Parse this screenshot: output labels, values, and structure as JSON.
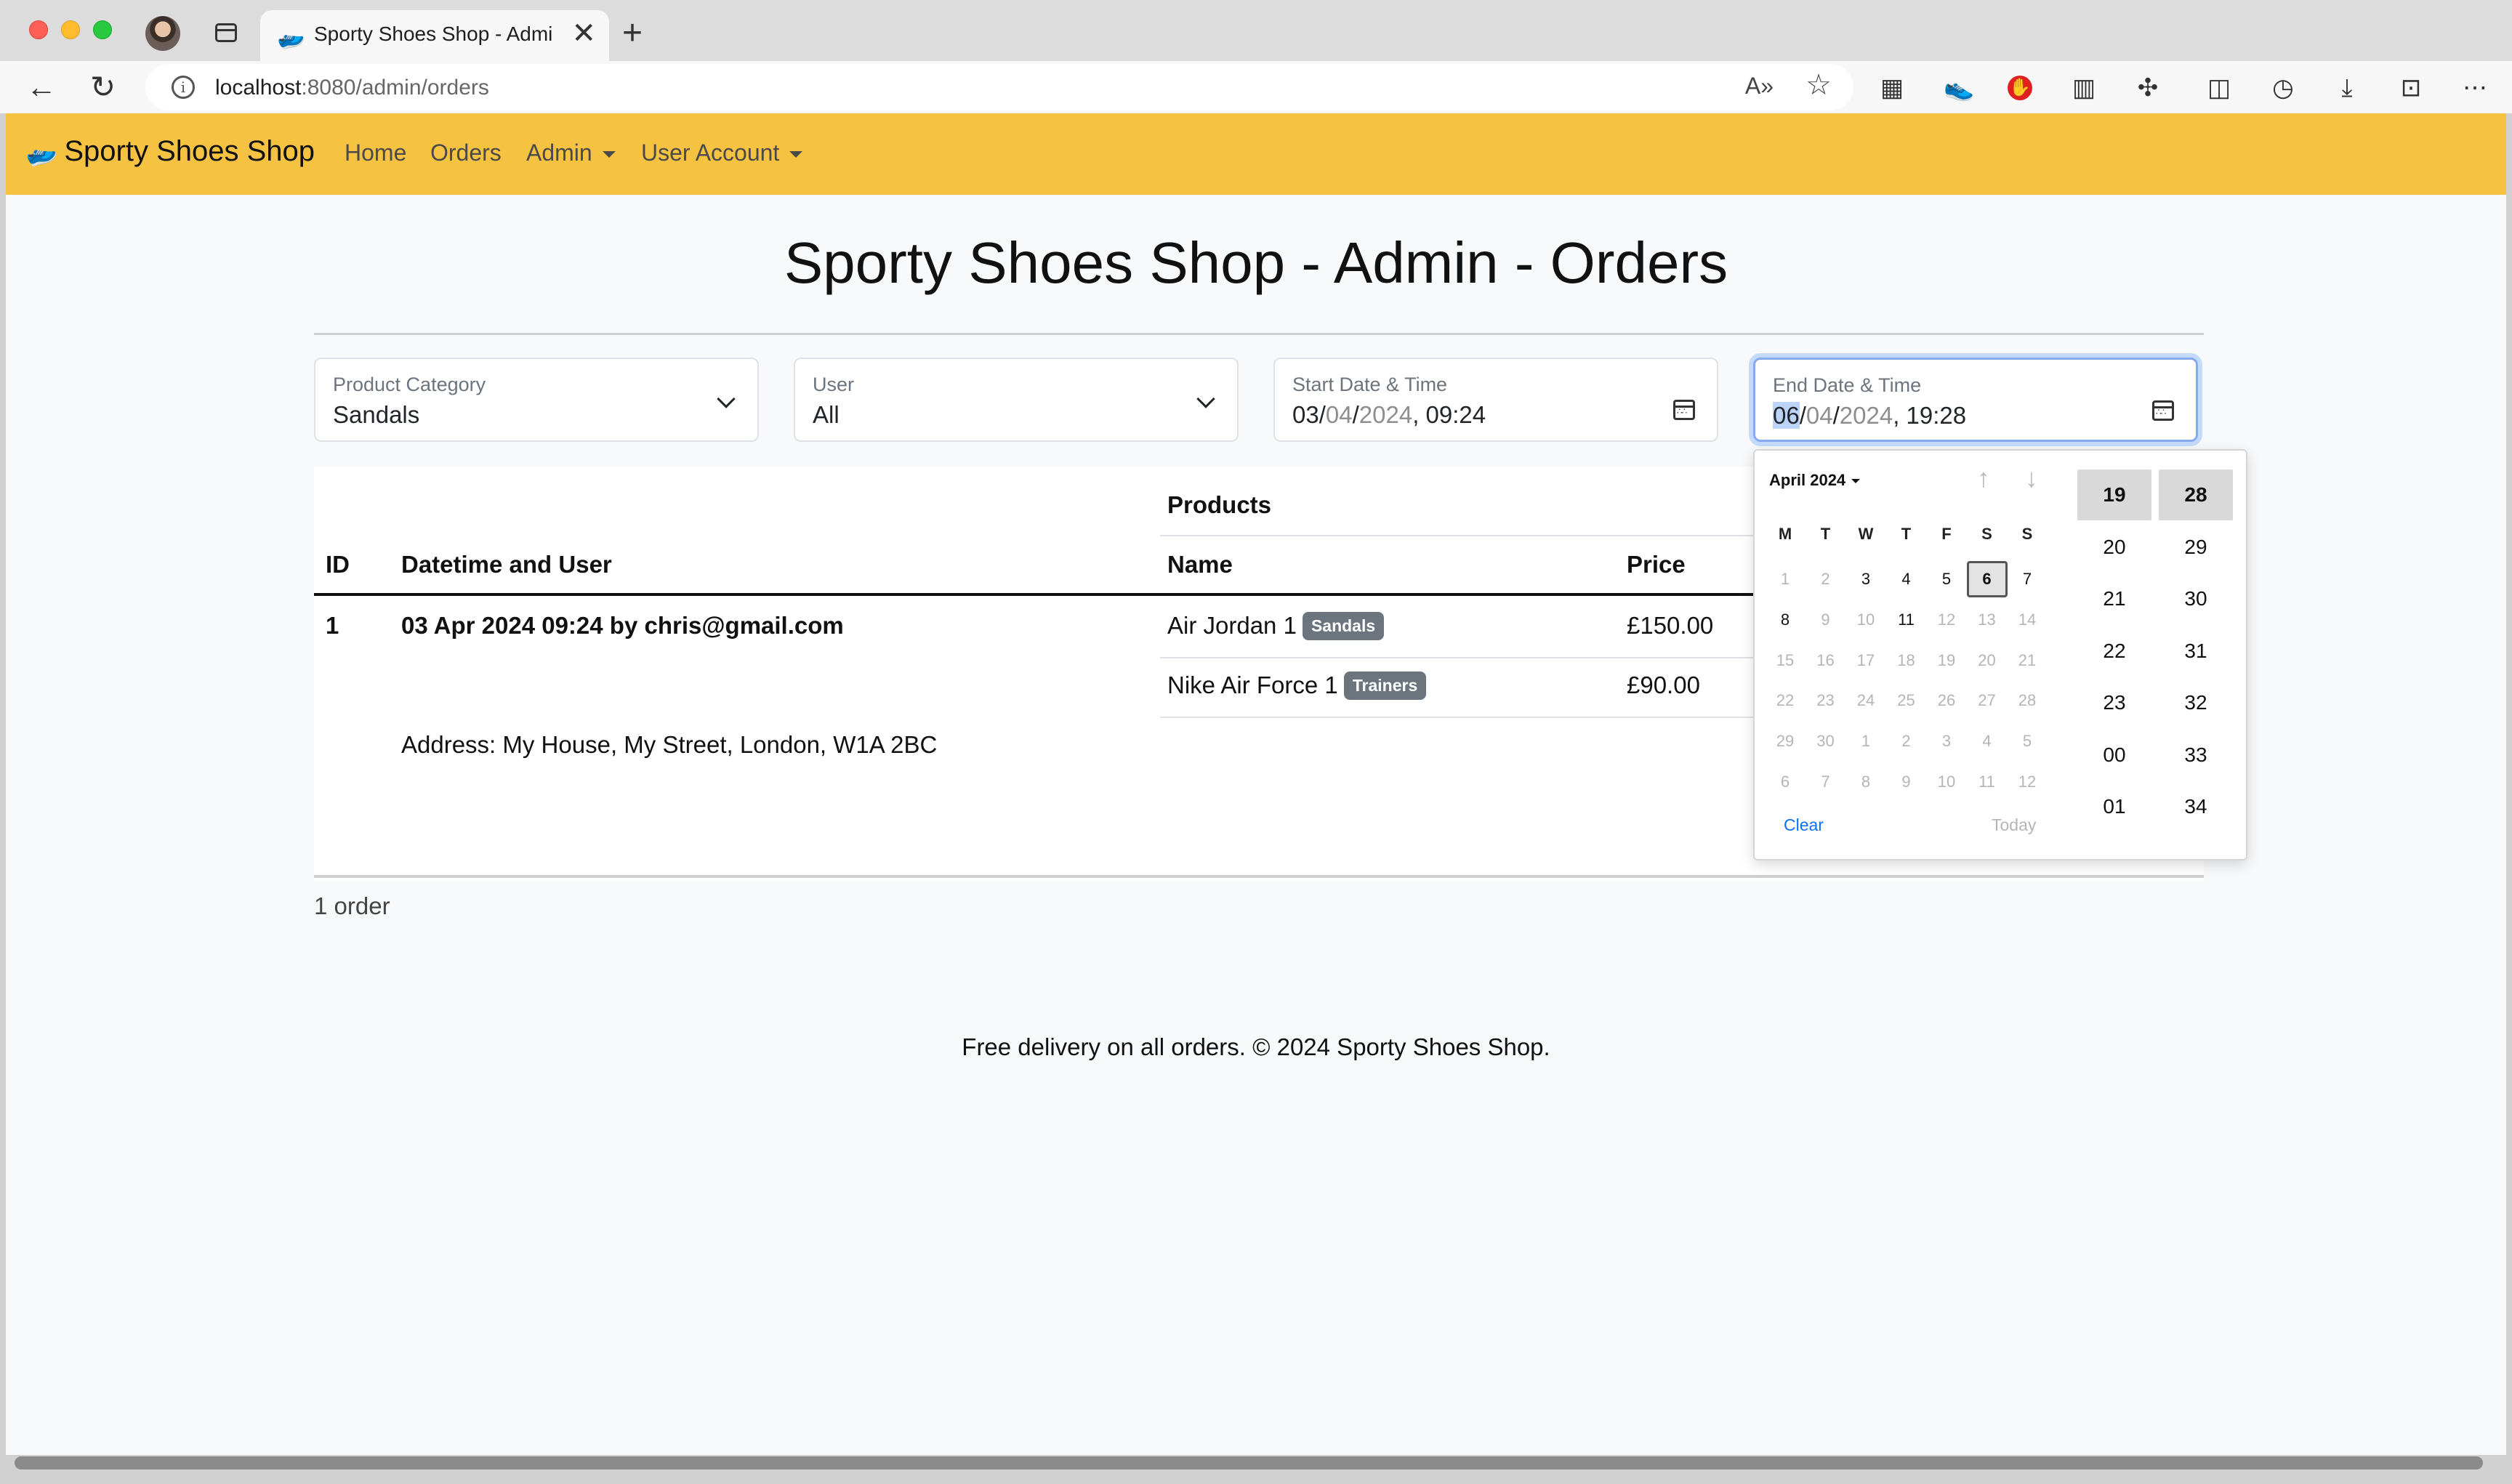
{
  "browser": {
    "tab_title": "Sporty Shoes Shop - Admin - Orders",
    "tab_close": "✕",
    "new_tab": "+",
    "url_host": "localhost",
    "url_rest": ":8080/admin/orders",
    "back": "←",
    "reload": "↻",
    "read_aloud": "A»",
    "favorite": "☆"
  },
  "navbar": {
    "brand": "Sporty Shoes Shop",
    "brand_icon": "shoe-icon",
    "links": [
      "Home",
      "Orders",
      "Admin",
      "User Account"
    ]
  },
  "page": {
    "title": "Sporty Shoes Shop - Admin - Orders"
  },
  "filters": {
    "category": {
      "label": "Product Category",
      "value": "Sandals"
    },
    "user": {
      "label": "User",
      "value": "All"
    },
    "start": {
      "label": "Start Date & Time",
      "day": "03",
      "month": "04",
      "year": "2024",
      "time": "09:24"
    },
    "end": {
      "label": "End Date & Time",
      "day": "06",
      "month": "04",
      "year": "2024",
      "time": "19:28"
    }
  },
  "table": {
    "group_header": "Products",
    "headers": {
      "id": "ID",
      "datetime_user": "Datetime and User",
      "name": "Name",
      "price": "Price"
    },
    "orders": [
      {
        "id": "1",
        "datetime_user": "03 Apr 2024 09:24 by chris@gmail.com",
        "address": "Address: My House, My Street, London, W1A 2BC",
        "items": [
          {
            "name": "Air Jordan 1",
            "category": "Sandals",
            "price": "£150.00"
          },
          {
            "name": "Nike Air Force 1",
            "category": "Trainers",
            "price": "£90.00"
          }
        ]
      }
    ]
  },
  "order_count": "1 order",
  "footer": "Free delivery on all orders. © 2024 Sporty Shoes Shop.",
  "picker": {
    "month_label": "April 2024",
    "weekdays": [
      "M",
      "T",
      "W",
      "T",
      "F",
      "S",
      "S"
    ],
    "weeks": [
      [
        "1",
        "2",
        "3",
        "4",
        "5",
        "6",
        "7"
      ],
      [
        "8",
        "9",
        "10",
        "11",
        "12",
        "13",
        "14"
      ],
      [
        "15",
        "16",
        "17",
        "18",
        "19",
        "20",
        "21"
      ],
      [
        "22",
        "23",
        "24",
        "25",
        "26",
        "27",
        "28"
      ],
      [
        "29",
        "30",
        "1",
        "2",
        "3",
        "4",
        "5"
      ],
      [
        "6",
        "7",
        "8",
        "9",
        "10",
        "11",
        "12"
      ]
    ],
    "enabled_days": [
      "3",
      "4",
      "5",
      "6",
      "7",
      "8",
      "11"
    ],
    "selected_day": "6",
    "hours": [
      "19",
      "20",
      "21",
      "22",
      "23",
      "00",
      "01"
    ],
    "minutes": [
      "28",
      "29",
      "30",
      "31",
      "32",
      "33",
      "34"
    ],
    "selected_hour": "19",
    "selected_minute": "28",
    "clear": "Clear",
    "today": "Today"
  },
  "colors": {
    "navbar": "#f5c242",
    "badge": "#6c757d",
    "link_blue": "#0d6efd"
  }
}
